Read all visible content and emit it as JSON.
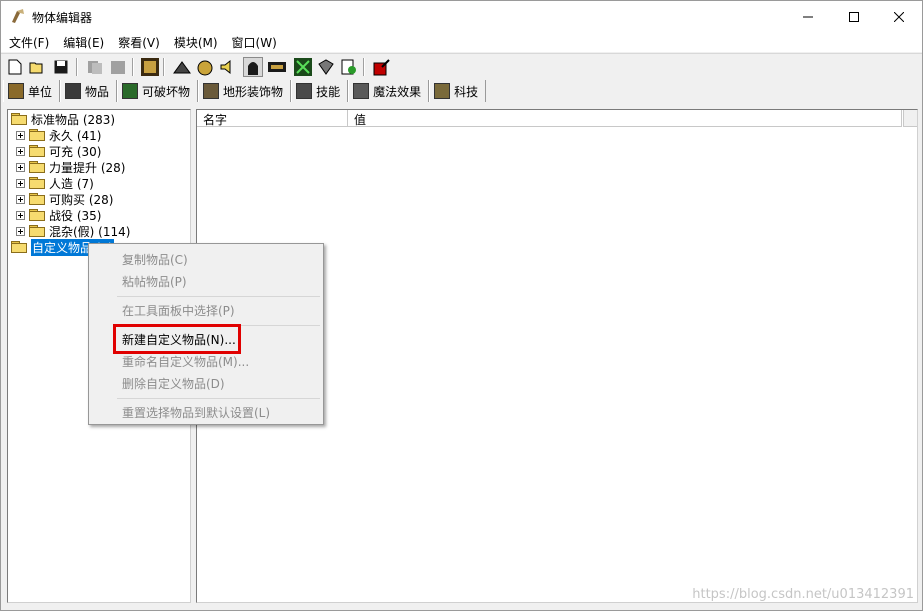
{
  "window": {
    "title": "物体编辑器"
  },
  "menubar": [
    "文件(F)",
    "编辑(E)",
    "察看(V)",
    "模块(M)",
    "窗口(W)"
  ],
  "toolbar": {
    "icons": [
      "new-file-icon",
      "open-folder-icon",
      "save-icon",
      "copy-icon",
      "paste-icon",
      "unit-editor-icon",
      "terrain-icon",
      "doodad-icon",
      "sound-icon",
      "unit-icon",
      "ai-editor-icon",
      "object-icon",
      "camera-icon",
      "import-icon",
      "test-map-icon"
    ]
  },
  "tabs": [
    {
      "label": "单位",
      "icon": "unit-tab-icon"
    },
    {
      "label": "物品",
      "icon": "item-tab-icon",
      "active": true
    },
    {
      "label": "可破坏物",
      "icon": "destructible-tab-icon"
    },
    {
      "label": "地形装饰物",
      "icon": "doodad-tab-icon"
    },
    {
      "label": "技能",
      "icon": "ability-tab-icon"
    },
    {
      "label": "魔法效果",
      "icon": "buff-tab-icon"
    },
    {
      "label": "科技",
      "icon": "upgrade-tab-icon"
    }
  ],
  "tree": {
    "root": "标准物品 (283)",
    "children": [
      "永久 (41)",
      "可充 (30)",
      "力量提升 (28)",
      "人造 (7)",
      "可购买 (28)",
      "战役 (35)",
      "混杂(假) (114)"
    ],
    "custom": "自定义物品 (0)"
  },
  "list": {
    "columns": [
      "名字",
      "值"
    ]
  },
  "context_menu": {
    "items": [
      {
        "label": "复制物品(C)",
        "enabled": false
      },
      {
        "label": "粘帖物品(P)",
        "enabled": false
      },
      {
        "label": "在工具面板中选择(P)",
        "enabled": false
      },
      {
        "label": "新建自定义物品(N)...",
        "enabled": true
      },
      {
        "label": "重命名自定义物品(M)...",
        "enabled": false
      },
      {
        "label": "删除自定义物品(D)",
        "enabled": false
      },
      {
        "label": "重置选择物品到默认设置(L)",
        "enabled": false
      }
    ]
  },
  "watermark": "https://blog.csdn.net/u013412391",
  "colors": {
    "selection": "#0078d7",
    "highlight": "#e00000",
    "folder": "#f6db6f"
  }
}
